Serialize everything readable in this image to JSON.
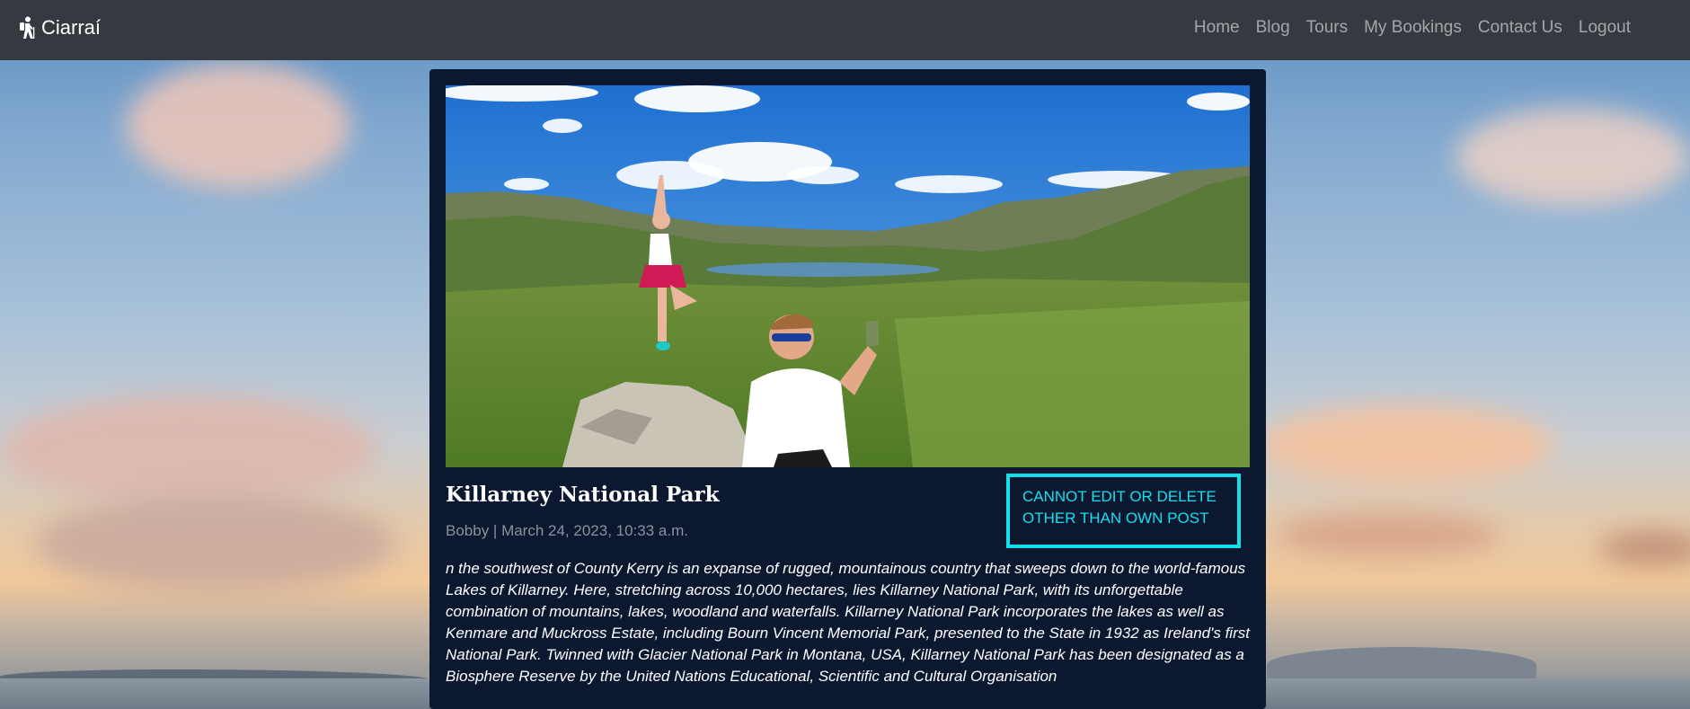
{
  "navbar": {
    "brand": "Ciarraí",
    "links": [
      "Home",
      "Blog",
      "Tours",
      "My Bookings",
      "Contact Us",
      "Logout"
    ]
  },
  "post": {
    "title": "Killarney National Park",
    "meta": "Bobby | March 24, 2023, 10:33 a.m.",
    "notice": "CANNOT EDIT OR DELETE OTHER THAN OWN POST",
    "body": "n the southwest of County Kerry is an expanse of rugged, mountainous country that sweeps down to the world-famous Lakes of Killarney. Here, stretching across 10,000 hectares, lies Killarney National Park, with its unforgettable combination of mountains, lakes, woodland and waterfalls. Killarney National Park incorporates the lakes as well as Kenmare and Muckross Estate, including Bourn Vincent Memorial Park, presented to the State in 1932 as Ireland's first National Park. Twinned with Glacier National Park in Montana, USA, Killarney National Park has been designated as a Biosphere Reserve by the United Nations Educational, Scientific and Cultural Organisation"
  },
  "icons": {
    "brand_icon": "hiker-icon"
  },
  "colors": {
    "navbar_bg": "#343a40",
    "card_bg": "#0c1730",
    "notice_accent": "#14e0ec"
  }
}
